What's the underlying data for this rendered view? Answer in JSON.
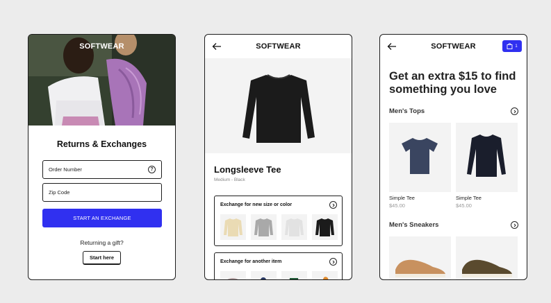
{
  "screen1": {
    "brand": "SOFTWEAR",
    "title": "Returns & Exchanges",
    "order_field_placeholder": "Order Number",
    "order_help_glyph": "?",
    "zip_field_placeholder": "Zip Code",
    "primary_button": "START AN EXCHANGE",
    "gift_prompt": "Returning a gift?",
    "gift_button": "Start here"
  },
  "screen2": {
    "brand": "SOFTWEAR",
    "back_icon": "arrow-left-icon",
    "product_name": "Longsleeve Tee",
    "product_variant": "Medium - Black",
    "exchange_size_title": "Exchange for new size or color",
    "exchange_item_title": "Exchange for another item",
    "color_options": [
      "cream",
      "heather-grey",
      "white",
      "black"
    ]
  },
  "screen3": {
    "brand": "SOFTWEAR",
    "cart_count": "1",
    "promo_heading": "Get an extra $15 to find something you love",
    "sections": [
      {
        "title": "Men's Tops",
        "items": [
          {
            "name": "Simple Tee",
            "price": "$45.00"
          },
          {
            "name": "Simple Tee",
            "price": "$45.00"
          }
        ]
      },
      {
        "title": "Men's Sneakers"
      }
    ]
  },
  "colors": {
    "accent": "#3030F0",
    "border": "#1C1C1C",
    "muted": "#888888",
    "panel": "#F3F3F3"
  }
}
